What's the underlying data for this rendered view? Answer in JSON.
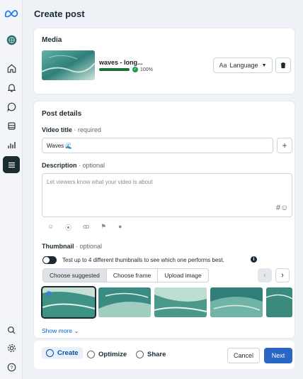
{
  "page": {
    "title": "Create post"
  },
  "media": {
    "section_title": "Media",
    "video_name": "waves - long...",
    "progress_percent": 100,
    "progress_label": "100%",
    "language_label": "Language",
    "language_prefix": "Aa"
  },
  "post_details": {
    "section_title": "Post details",
    "video_title_label": "Video title",
    "video_title_qualifier": " · required",
    "video_title_value": "Waves 🌊",
    "description_label": "Description",
    "description_qualifier": " · optional",
    "description_placeholder": "Let viewers know what your video is about",
    "thumbnail_label": "Thumbnail",
    "thumbnail_qualifier": " · optional",
    "thumbnail_test_text": "Test up to 4 different thumbnails to see which one performs best.",
    "tabs": [
      "Choose suggested",
      "Choose frame",
      "Upload image"
    ],
    "show_more": "Show more"
  },
  "footer": {
    "steps": [
      "Create",
      "Optimize",
      "Share"
    ],
    "cancel_label": "Cancel",
    "next_label": "Next"
  },
  "colors": {
    "accent": "#2a66c6",
    "dark": "#1c2b33",
    "success": "#1e9e4a"
  }
}
